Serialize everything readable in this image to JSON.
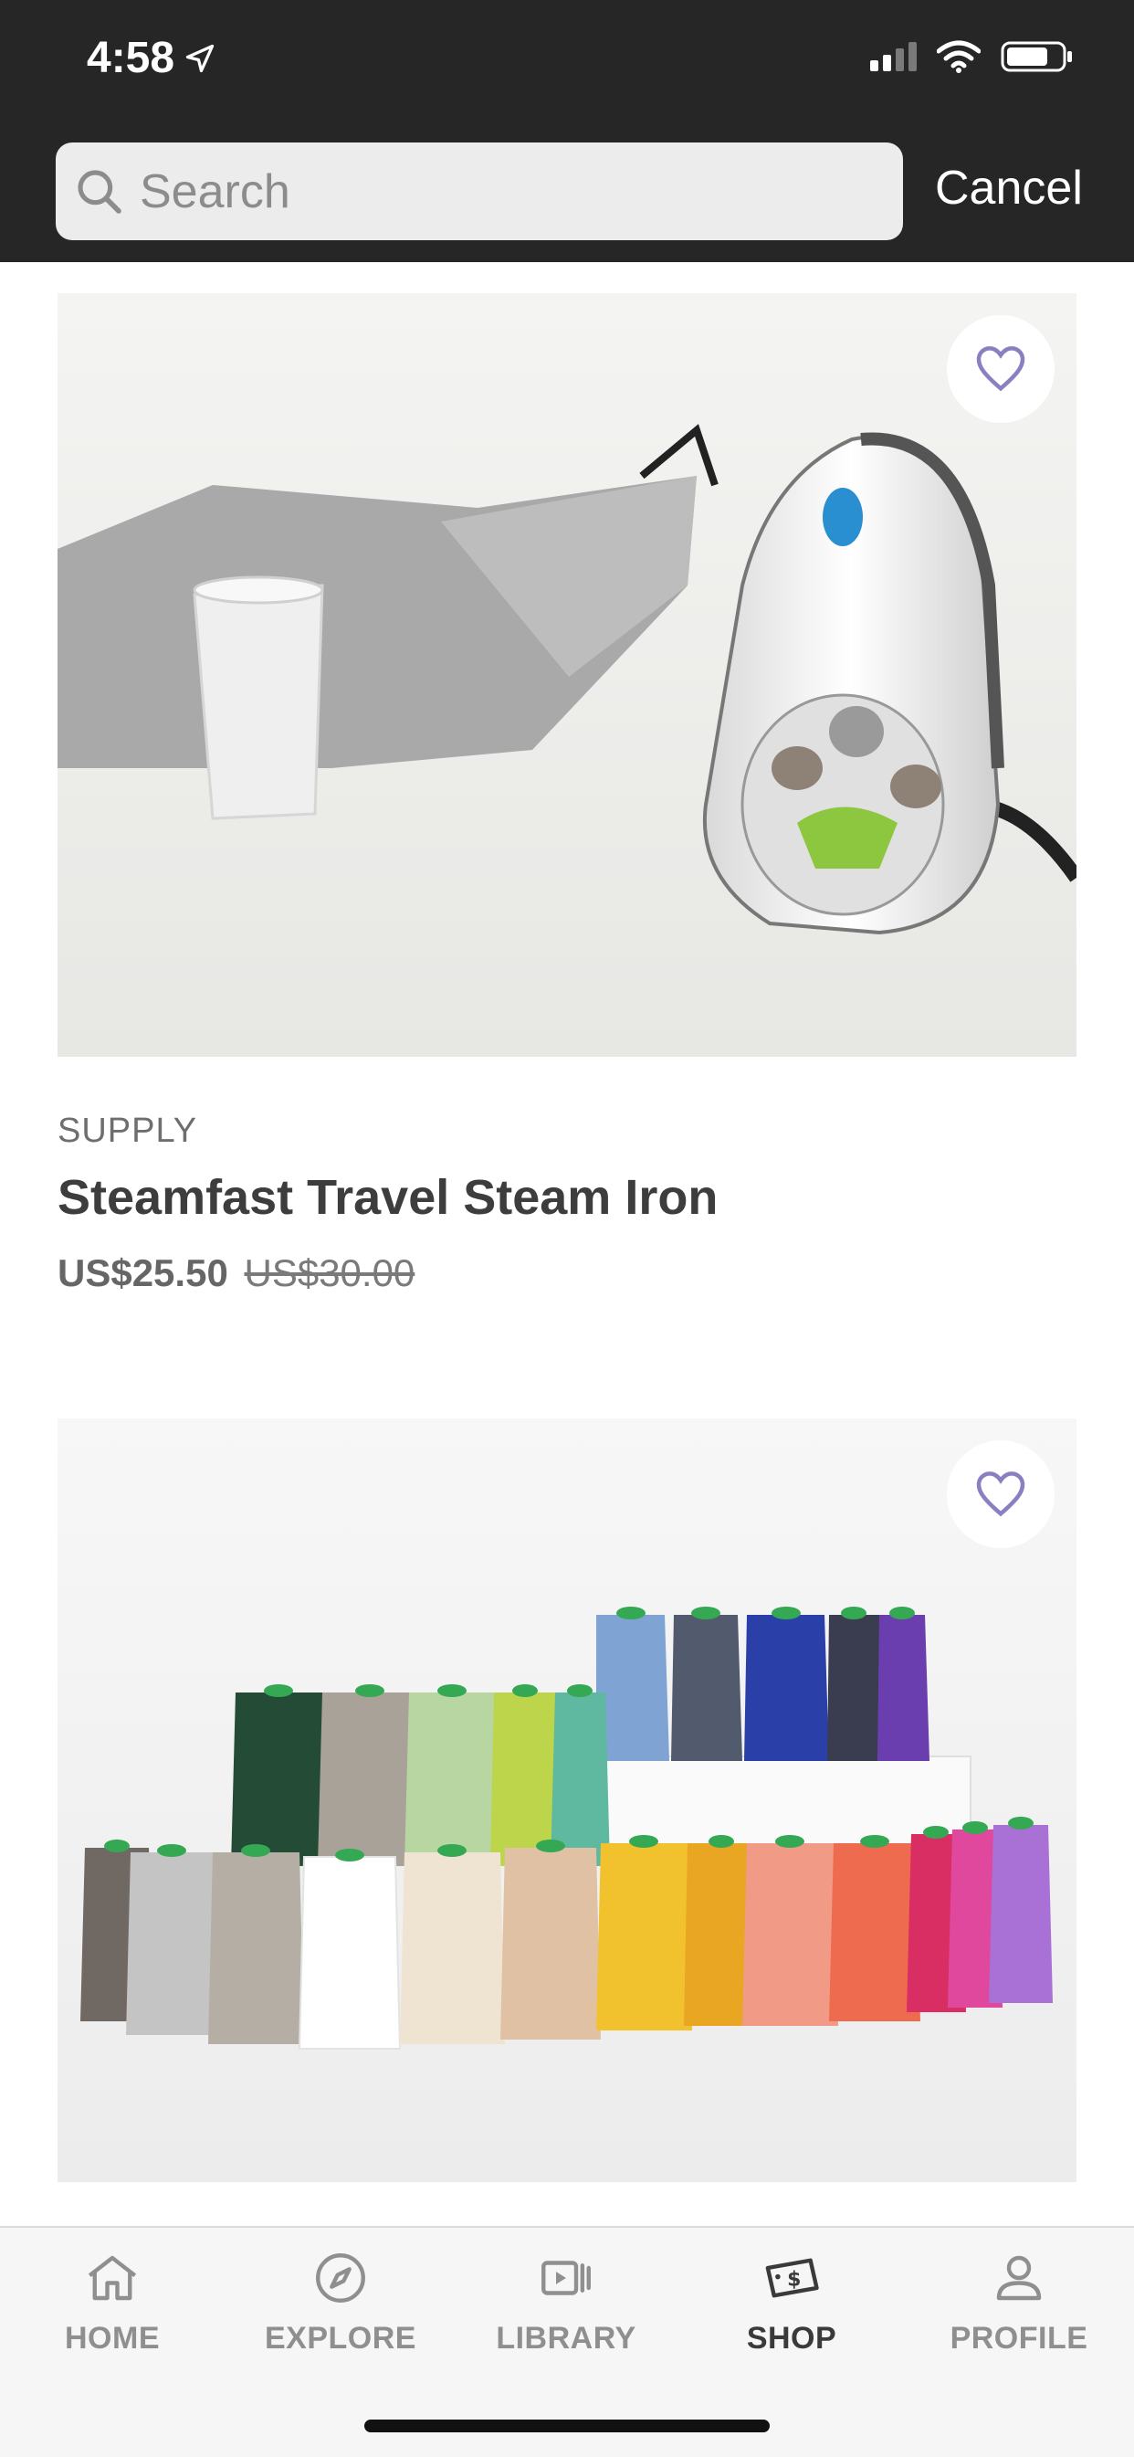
{
  "status_bar": {
    "time": "4:58"
  },
  "search": {
    "placeholder": "Search",
    "cancel_label": "Cancel"
  },
  "products": [
    {
      "category": "SUPPLY",
      "title": "Steamfast Travel Steam Iron",
      "price": "US$25.50",
      "original_price": "US$30.00"
    },
    {}
  ],
  "tabs": [
    {
      "label": "HOME",
      "icon": "home-icon"
    },
    {
      "label": "EXPLORE",
      "icon": "compass-icon"
    },
    {
      "label": "LIBRARY",
      "icon": "video-library-icon"
    },
    {
      "label": "SHOP",
      "icon": "price-tag-icon",
      "active": true
    },
    {
      "label": "PROFILE",
      "icon": "user-icon"
    }
  ],
  "colors": {
    "topbar": "#262626",
    "heart": "#8a7fc0",
    "active_tab": "#3a3a3a",
    "inactive_tab": "#8f8f8f"
  }
}
